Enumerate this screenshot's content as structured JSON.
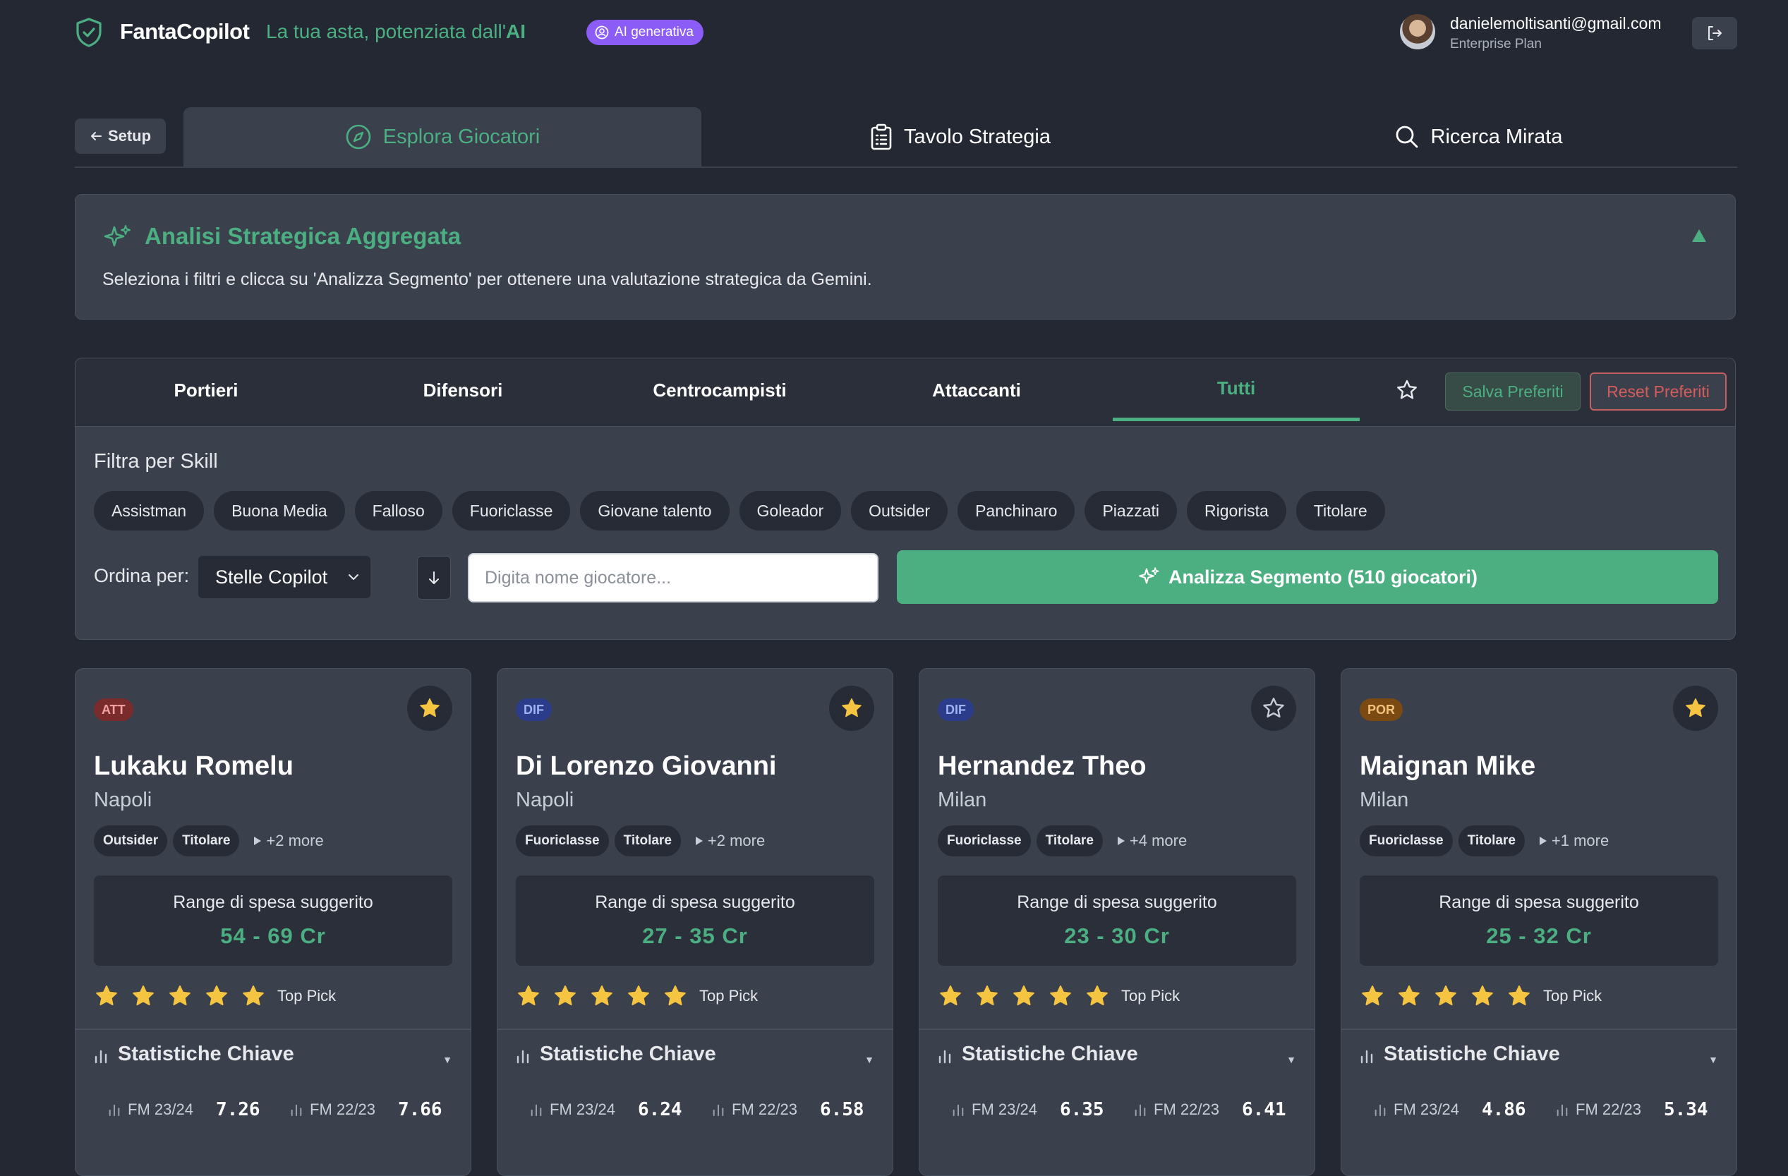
{
  "header": {
    "brand": "FantaCopilot",
    "tagline_prefix": "La tua asta, potenziata dall'",
    "tagline_ai": "AI",
    "ai_badge": "AI generativa",
    "user_email": "danielemoltisanti@gmail.com",
    "user_plan": "Enterprise Plan"
  },
  "nav": {
    "setup": "Setup",
    "tabs": [
      {
        "label": "Esplora Giocatori",
        "icon": "compass-icon"
      },
      {
        "label": "Tavolo Strategia",
        "icon": "clipboard-icon"
      },
      {
        "label": "Ricerca Mirata",
        "icon": "search-icon"
      }
    ],
    "active_tab": "Esplora Giocatori"
  },
  "analysis": {
    "title": "Analisi Strategica Aggregata",
    "description": "Seleziona i filtri e clicca su 'Analizza Segmento' per ottenere una valutazione strategica da Gemini."
  },
  "filters": {
    "role_tabs": [
      "Portieri",
      "Difensori",
      "Centrocampisti",
      "Attaccanti",
      "Tutti"
    ],
    "active_role": "Tutti",
    "save_favorites": "Salva Preferiti",
    "reset_favorites": "Reset Preferiti",
    "skill_label": "Filtra per Skill",
    "skills": [
      "Assistman",
      "Buona Media",
      "Falloso",
      "Fuoriclasse",
      "Giovane talento",
      "Goleador",
      "Outsider",
      "Panchinaro",
      "Piazzati",
      "Rigorista",
      "Titolare"
    ],
    "sort_label": "Ordina per:",
    "sort_value": "Stelle Copilot",
    "search_placeholder": "Digita nome giocatore...",
    "analyze_button": "Analizza Segmento (510 giocatori)"
  },
  "cards": [
    {
      "role": "ATT",
      "favorite": true,
      "name": "Lukaku Romelu",
      "team": "Napoli",
      "tags": [
        "Outsider",
        "Titolare"
      ],
      "more": "+2 more",
      "range_label": "Range di spesa suggerito",
      "range": "54 - 69 Cr",
      "stars": 5,
      "rating_label": "Top Pick",
      "stats_title": "Statistiche Chiave",
      "stats": [
        {
          "label": "FM 23/24",
          "value": "7.26"
        },
        {
          "label": "FM 22/23",
          "value": "7.66"
        }
      ]
    },
    {
      "role": "DIF",
      "favorite": true,
      "name": "Di Lorenzo Giovanni",
      "team": "Napoli",
      "tags": [
        "Fuoriclasse",
        "Titolare"
      ],
      "more": "+2 more",
      "range_label": "Range di spesa suggerito",
      "range": "27 - 35 Cr",
      "stars": 5,
      "rating_label": "Top Pick",
      "stats_title": "Statistiche Chiave",
      "stats": [
        {
          "label": "FM 23/24",
          "value": "6.24"
        },
        {
          "label": "FM 22/23",
          "value": "6.58"
        }
      ]
    },
    {
      "role": "DIF",
      "favorite": false,
      "name": "Hernandez Theo",
      "team": "Milan",
      "tags": [
        "Fuoriclasse",
        "Titolare"
      ],
      "more": "+4 more",
      "range_label": "Range di spesa suggerito",
      "range": "23 - 30 Cr",
      "stars": 5,
      "rating_label": "Top Pick",
      "stats_title": "Statistiche Chiave",
      "stats": [
        {
          "label": "FM 23/24",
          "value": "6.35"
        },
        {
          "label": "FM 22/23",
          "value": "6.41"
        }
      ]
    },
    {
      "role": "POR",
      "favorite": true,
      "name": "Maignan Mike",
      "team": "Milan",
      "tags": [
        "Fuoriclasse",
        "Titolare"
      ],
      "more": "+1 more",
      "range_label": "Range di spesa suggerito",
      "range": "25 - 32 Cr",
      "stars": 5,
      "rating_label": "Top Pick",
      "stats_title": "Statistiche Chiave",
      "stats": [
        {
          "label": "FM 23/24",
          "value": "4.86"
        },
        {
          "label": "FM 22/23",
          "value": "5.34"
        }
      ]
    }
  ],
  "colors": {
    "background": "#232833",
    "panel": "#3a404c",
    "accent": "#4caf82",
    "ai_badge": "#8b5cf6",
    "star": "#f5c542",
    "danger": "#d65c5c"
  }
}
